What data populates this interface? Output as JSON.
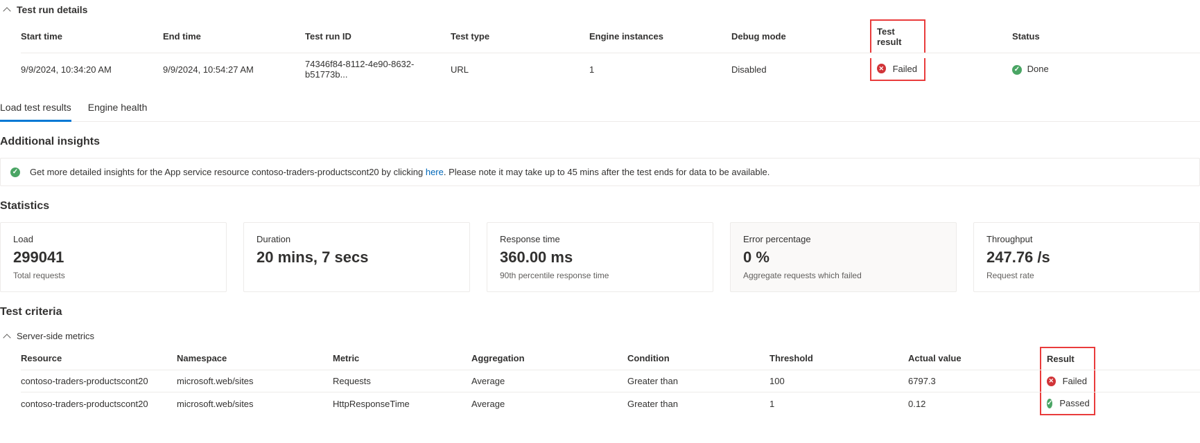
{
  "details": {
    "header": "Test run details",
    "columns": {
      "start": "Start time",
      "end": "End time",
      "runid": "Test run ID",
      "type": "Test type",
      "engine": "Engine instances",
      "debug": "Debug mode",
      "result": "Test result",
      "status": "Status"
    },
    "row": {
      "start": "9/9/2024, 10:34:20 AM",
      "end": "9/9/2024, 10:54:27 AM",
      "runid": "74346f84-8112-4e90-8632-b51773b...",
      "type": "URL",
      "engine": "1",
      "debug": "Disabled",
      "result": "Failed",
      "status": "Done"
    }
  },
  "tabs": {
    "load": "Load test results",
    "engine": "Engine health"
  },
  "insights": {
    "title": "Additional insights",
    "text_prefix": "Get more detailed insights for the App service resource contoso-traders-productscont20 by clicking ",
    "link": "here",
    "text_suffix": ". Please note it may take up to 45 mins after the test ends for data to be available."
  },
  "statistics": {
    "title": "Statistics",
    "cards": {
      "load": {
        "label": "Load",
        "value": "299041",
        "sub": "Total requests"
      },
      "duration": {
        "label": "Duration",
        "value": "20 mins, 7 secs",
        "sub": ""
      },
      "response": {
        "label": "Response time",
        "value": "360.00 ms",
        "sub": "90th percentile response time"
      },
      "error": {
        "label": "Error percentage",
        "value": "0 %",
        "sub": "Aggregate requests which failed"
      },
      "throughput": {
        "label": "Throughput",
        "value": "247.76 /s",
        "sub": "Request rate"
      }
    }
  },
  "criteria": {
    "title": "Test criteria",
    "subheader": "Server-side metrics",
    "columns": {
      "resource": "Resource",
      "namespace": "Namespace",
      "metric": "Metric",
      "aggregation": "Aggregation",
      "condition": "Condition",
      "threshold": "Threshold",
      "actual": "Actual value",
      "result": "Result"
    },
    "rows": [
      {
        "resource": "contoso-traders-productscont20",
        "namespace": "microsoft.web/sites",
        "metric": "Requests",
        "aggregation": "Average",
        "condition": "Greater than",
        "threshold": "100",
        "actual": "6797.3",
        "result": "Failed",
        "pass": false
      },
      {
        "resource": "contoso-traders-productscont20",
        "namespace": "microsoft.web/sites",
        "metric": "HttpResponseTime",
        "aggregation": "Average",
        "condition": "Greater than",
        "threshold": "1",
        "actual": "0.12",
        "result": "Passed",
        "pass": true
      }
    ]
  }
}
